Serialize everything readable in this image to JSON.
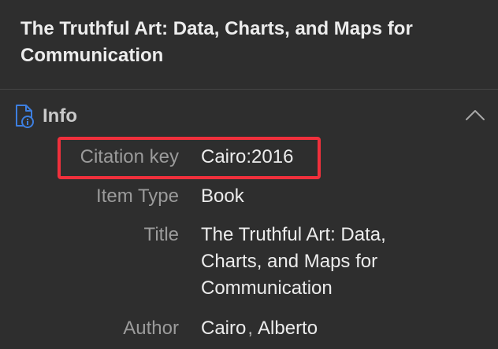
{
  "header": {
    "title": "The Truthful Art: Data, Charts, and Maps for Communication"
  },
  "section": {
    "title": "Info",
    "icon": "document-info-icon",
    "toggle_icon": "chevron-up-icon"
  },
  "fields": {
    "citation_key": {
      "label": "Citation key",
      "value": "Cairo:2016"
    },
    "item_type": {
      "label": "Item Type",
      "value": "Book"
    },
    "title": {
      "label": "Title",
      "value": "The Truthful Art: Data, Charts, and Maps for Communication"
    },
    "author": {
      "label": "Author",
      "last": "Cairo",
      "separator": ",",
      "first": "Alberto"
    }
  },
  "colors": {
    "background": "#2e2e2e",
    "highlight": "#f0303c",
    "icon_blue": "#3d7fe0"
  }
}
